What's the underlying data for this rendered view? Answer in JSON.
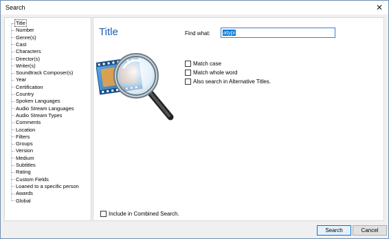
{
  "window": {
    "title": "Search"
  },
  "tree": {
    "items": [
      "Title",
      "Number",
      "Genre(s)",
      "Cast",
      "Characters",
      "Director(s)",
      "Writer(s)",
      "Soundtrack Composer(s)",
      "Year",
      "Certification",
      "Country",
      "Spoken Languages",
      "Audio Stream Languages",
      "Audio Stream Types",
      "Comments",
      "Location",
      "Filters",
      "Groups",
      "Version",
      "Medium",
      "Subtitles",
      "Rating",
      "Custom Fields",
      "Loaned to a specific person",
      "Awards",
      "Global"
    ],
    "selected": "Title"
  },
  "panel": {
    "title": "Title",
    "find_label": "Find what:",
    "find_value": "atypi",
    "options": [
      "Match case",
      "Match whole word",
      "Also search in Alternative Titles."
    ],
    "combined_label": "Include in Combined Search."
  },
  "buttons": {
    "search": "Search",
    "cancel": "Cancel"
  },
  "icons": {
    "close": "close-icon",
    "art": "magnifier-film-icon"
  }
}
